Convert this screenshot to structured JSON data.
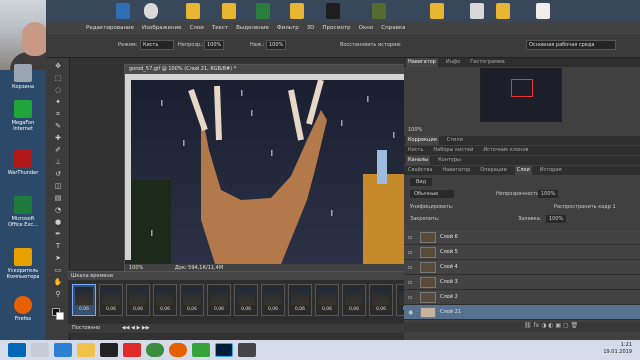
{
  "desktop": {
    "icons": [
      {
        "label": "Корзина",
        "icon": "recycle-bin-icon",
        "color": "#9aa6b2"
      },
      {
        "label": "MegaFon Internet",
        "icon": "megafon-icon",
        "color": "#1ea53c"
      },
      {
        "label": "WarThunder",
        "icon": "warthunder-icon",
        "color": "#b11818"
      },
      {
        "label": "Microsoft Office Exc...",
        "icon": "excel-icon",
        "color": "#1f7a3d"
      },
      {
        "label": "Ускоритель Компьютера",
        "icon": "speedometer-icon",
        "color": "#e7a200"
      },
      {
        "label": "Firefox",
        "icon": "firefox-icon",
        "color": "#e66000"
      }
    ]
  },
  "menubar": [
    "Редактирование",
    "Изображение",
    "Слои",
    "Текст",
    "Выделение",
    "Фильтр",
    "3D",
    "Просмотр",
    "Окно",
    "Справка"
  ],
  "options_bar": {
    "mode_label": "Режим:",
    "mode_value": "Кисть",
    "opacity_label": "Непрозр.:",
    "opacity_value": "100%",
    "flow_label": "Наж.:",
    "flow_value": "100%",
    "history_label": "Восстановить историю",
    "workspace": "Основная рабочая среда"
  },
  "document": {
    "tab": "gorod_57.gif @ 100% (Слой 21, RGB/8#) *",
    "zoom": "100%",
    "doc_size": "Док: 594,1К/11,4М"
  },
  "timeline": {
    "title": "Шкала времени",
    "frames": [
      "0,06",
      "0,06",
      "0,06",
      "0,06",
      "0,06",
      "0,06",
      "0,06",
      "0,06",
      "0,06",
      "0,06",
      "0,06",
      "0,06",
      "0,06"
    ],
    "loop": "Постоянно"
  },
  "panels": {
    "nav_tabs": [
      "Навигатор",
      "Инфо",
      "Гистограмма"
    ],
    "nav_zoom": "100%",
    "correction_tabs": [
      "Коррекция",
      "Стили"
    ],
    "brush_tabs": [
      "Кисть",
      "Наборы кистей",
      "Источник клонов"
    ],
    "channel_tabs": [
      "Каналы",
      "Контуры"
    ],
    "props_tabs": [
      "Свойства",
      "Навигатор",
      "Операции",
      "Слои",
      "История"
    ],
    "kind": "Вид",
    "blend": "Обычные",
    "opacity_label": "Непрозрачность:",
    "opacity_value": "100%",
    "unify_label": "Унифицировать:",
    "propagate": "Распространить кадр 1",
    "lock_label": "Закрепить:",
    "fill_label": "Заливка:",
    "fill_value": "100%",
    "layers": [
      "Слой 6",
      "Слой 5",
      "Слой 4",
      "Слой 3",
      "Слой 2",
      "Слой 21"
    ]
  },
  "taskbar": {
    "items": [
      "start-icon",
      "search-icon",
      "edge-icon",
      "explorer-icon",
      "yandex-icon",
      "chrome-icon",
      "firefox-icon",
      "utorrent-icon",
      "photoshop-icon",
      "video-icon"
    ],
    "time": "1:21",
    "date": "19.01.2019"
  }
}
